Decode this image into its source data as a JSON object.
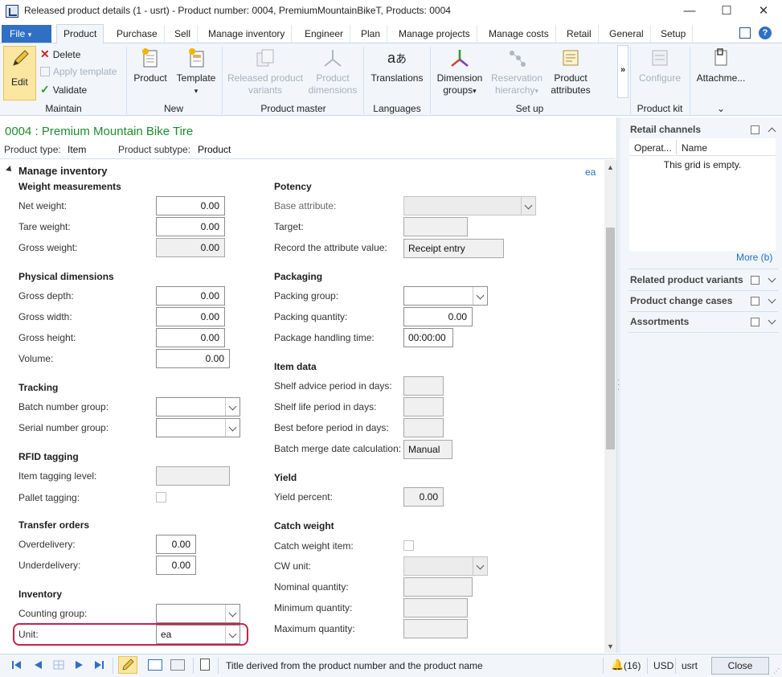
{
  "window": {
    "title": "Released product details (1 - usrt) - Product number: 0004, PremiumMountainBikeT, Products: 0004",
    "minimize": "—",
    "maximize": "☐",
    "close": "✕"
  },
  "tabs": [
    "File",
    "Product",
    "Purchase",
    "Sell",
    "Manage inventory",
    "Engineer",
    "Plan",
    "Manage projects",
    "Manage costs",
    "Retail",
    "General",
    "Setup"
  ],
  "ribbon": {
    "maintain": {
      "label": "Maintain",
      "edit": "Edit",
      "delete": "Delete",
      "apply_template": "Apply template",
      "validate": "Validate"
    },
    "new": {
      "label": "New",
      "product": "Product",
      "template": "Template"
    },
    "product_master": {
      "label": "Product master",
      "released_variants_1": "Released product",
      "released_variants_2": "variants",
      "product_dimensions_1": "Product",
      "product_dimensions_2": "dimensions"
    },
    "languages": {
      "label": "Languages",
      "translations": "Translations"
    },
    "setup": {
      "label": "Set up",
      "dimension_groups_1": "Dimension",
      "dimension_groups_2": "groups",
      "reservation_hierarchy_1": "Reservation",
      "reservation_hierarchy_2": "hierarchy",
      "product_attributes_1": "Product",
      "product_attributes_2": "attributes"
    },
    "more": "»",
    "product_kit": {
      "label": "Product kit",
      "configure": "Configure"
    },
    "attachments": "Attachme...",
    "expand": "⌄"
  },
  "header": {
    "title": "0004 : Premium Mountain Bike Tire",
    "product_type_label": "Product type:",
    "product_type_value": "Item",
    "product_subtype_label": "Product subtype:",
    "product_subtype_value": "Product"
  },
  "section": {
    "title": "Manage inventory",
    "unit_link": "ea"
  },
  "left": {
    "weight": {
      "title": "Weight measurements",
      "net_label": "Net weight:",
      "net": "0.00",
      "tare_label": "Tare weight:",
      "tare": "0.00",
      "gross_label": "Gross weight:",
      "gross": "0.00"
    },
    "physical": {
      "title": "Physical dimensions",
      "depth_label": "Gross depth:",
      "depth": "0.00",
      "width_label": "Gross width:",
      "width": "0.00",
      "height_label": "Gross height:",
      "height": "0.00",
      "volume_label": "Volume:",
      "volume": "0.00"
    },
    "tracking": {
      "title": "Tracking",
      "batch_label": "Batch number group:",
      "serial_label": "Serial number group:"
    },
    "rfid": {
      "title": "RFID tagging",
      "item_label": "Item tagging level:",
      "pallet_label": "Pallet tagging:"
    },
    "transfer": {
      "title": "Transfer orders",
      "over_label": "Overdelivery:",
      "over": "0.00",
      "under_label": "Underdelivery:",
      "under": "0.00"
    },
    "inventory": {
      "title": "Inventory",
      "counting_label": "Counting group:",
      "unit_label": "Unit:",
      "unit": "ea"
    }
  },
  "right": {
    "potency": {
      "title": "Potency",
      "base_label": "Base attribute:",
      "target_label": "Target:",
      "record_label": "Record the attribute value:",
      "record": "Receipt entry"
    },
    "packaging": {
      "title": "Packaging",
      "group_label": "Packing group:",
      "qty_label": "Packing quantity:",
      "qty": "0.00",
      "time_label": "Package handling time:",
      "time": "00:00:00"
    },
    "item_data": {
      "title": "Item data",
      "shelf_advice_label": "Shelf advice period in days:",
      "shelf_life_label": "Shelf life period in days:",
      "best_before_label": "Best before period in days:",
      "batch_merge_label": "Batch merge date calculation:",
      "batch_merge": "Manual"
    },
    "yield": {
      "title": "Yield",
      "percent_label": "Yield percent:",
      "percent": "0.00"
    },
    "catch_weight": {
      "title": "Catch weight",
      "item_label": "Catch weight item:",
      "unit_label": "CW unit:",
      "nominal_label": "Nominal quantity:",
      "min_label": "Minimum quantity:",
      "max_label": "Maximum quantity:"
    }
  },
  "factbox": {
    "retail_channels": "Retail channels",
    "col_operating": "Operat...",
    "col_name": "Name",
    "empty": "This grid is empty.",
    "more": "More (b)",
    "related_variants": "Related product variants",
    "change_cases": "Product change cases",
    "assortments": "Assortments"
  },
  "status": {
    "text": "Title derived from the product number and the product name",
    "notifications": "(16)",
    "currency": "USD",
    "company": "usrt",
    "close": "Close"
  }
}
